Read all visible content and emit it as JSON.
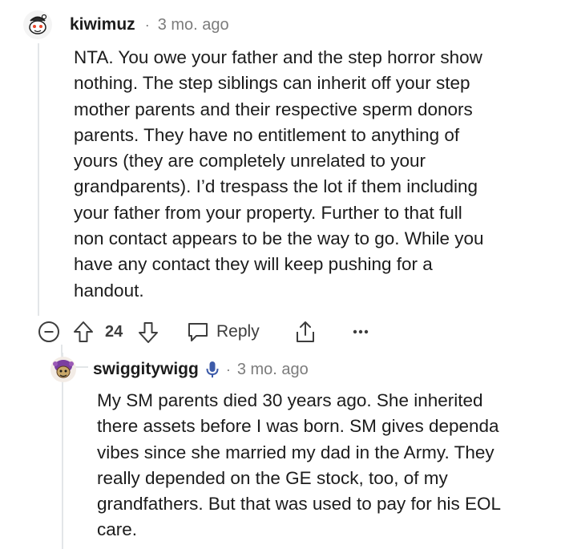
{
  "comments": [
    {
      "username": "kiwimuz",
      "separator": "·",
      "timestamp": "3 mo. ago",
      "body_lines": [
        "NTA. You owe your father and the step horror show",
        "nothing. The step siblings can inherit off your step",
        "mother parents and their respective sperm donors",
        "parents. They have no entitlement to anything of",
        "yours (they are completely unrelated to your",
        "grandparents). I’d trespass the lot if them including",
        "your father from your property. Further to that full",
        "non contact appears to be the way to go. While you",
        "have any contact they will keep pushing for a",
        "handout."
      ],
      "actions": {
        "score": "24",
        "reply_label": "Reply"
      }
    },
    {
      "username": "swiggitywigg",
      "separator": "·",
      "timestamp": "3 mo. ago",
      "body_lines": [
        "My SM parents died 30 years ago. She inherited",
        "there assets before I was born. SM gives dependa",
        "vibes since she married my dad in the Army. They",
        "really depended on the GE stock, too, of my",
        "grandfathers. But that was used to pay for his EOL",
        "care."
      ]
    }
  ],
  "colors": {
    "text": "#1c1c1c",
    "meta": "#7c7c7c",
    "icon": "#3d3d3d",
    "thread_line": "#e3e6e8",
    "avatar_purple": "#7b3fa0"
  },
  "icons": [
    "collapse-icon",
    "upvote-icon",
    "downvote-icon",
    "reply-bubble-icon",
    "share-icon",
    "more-icon",
    "mic-icon"
  ]
}
